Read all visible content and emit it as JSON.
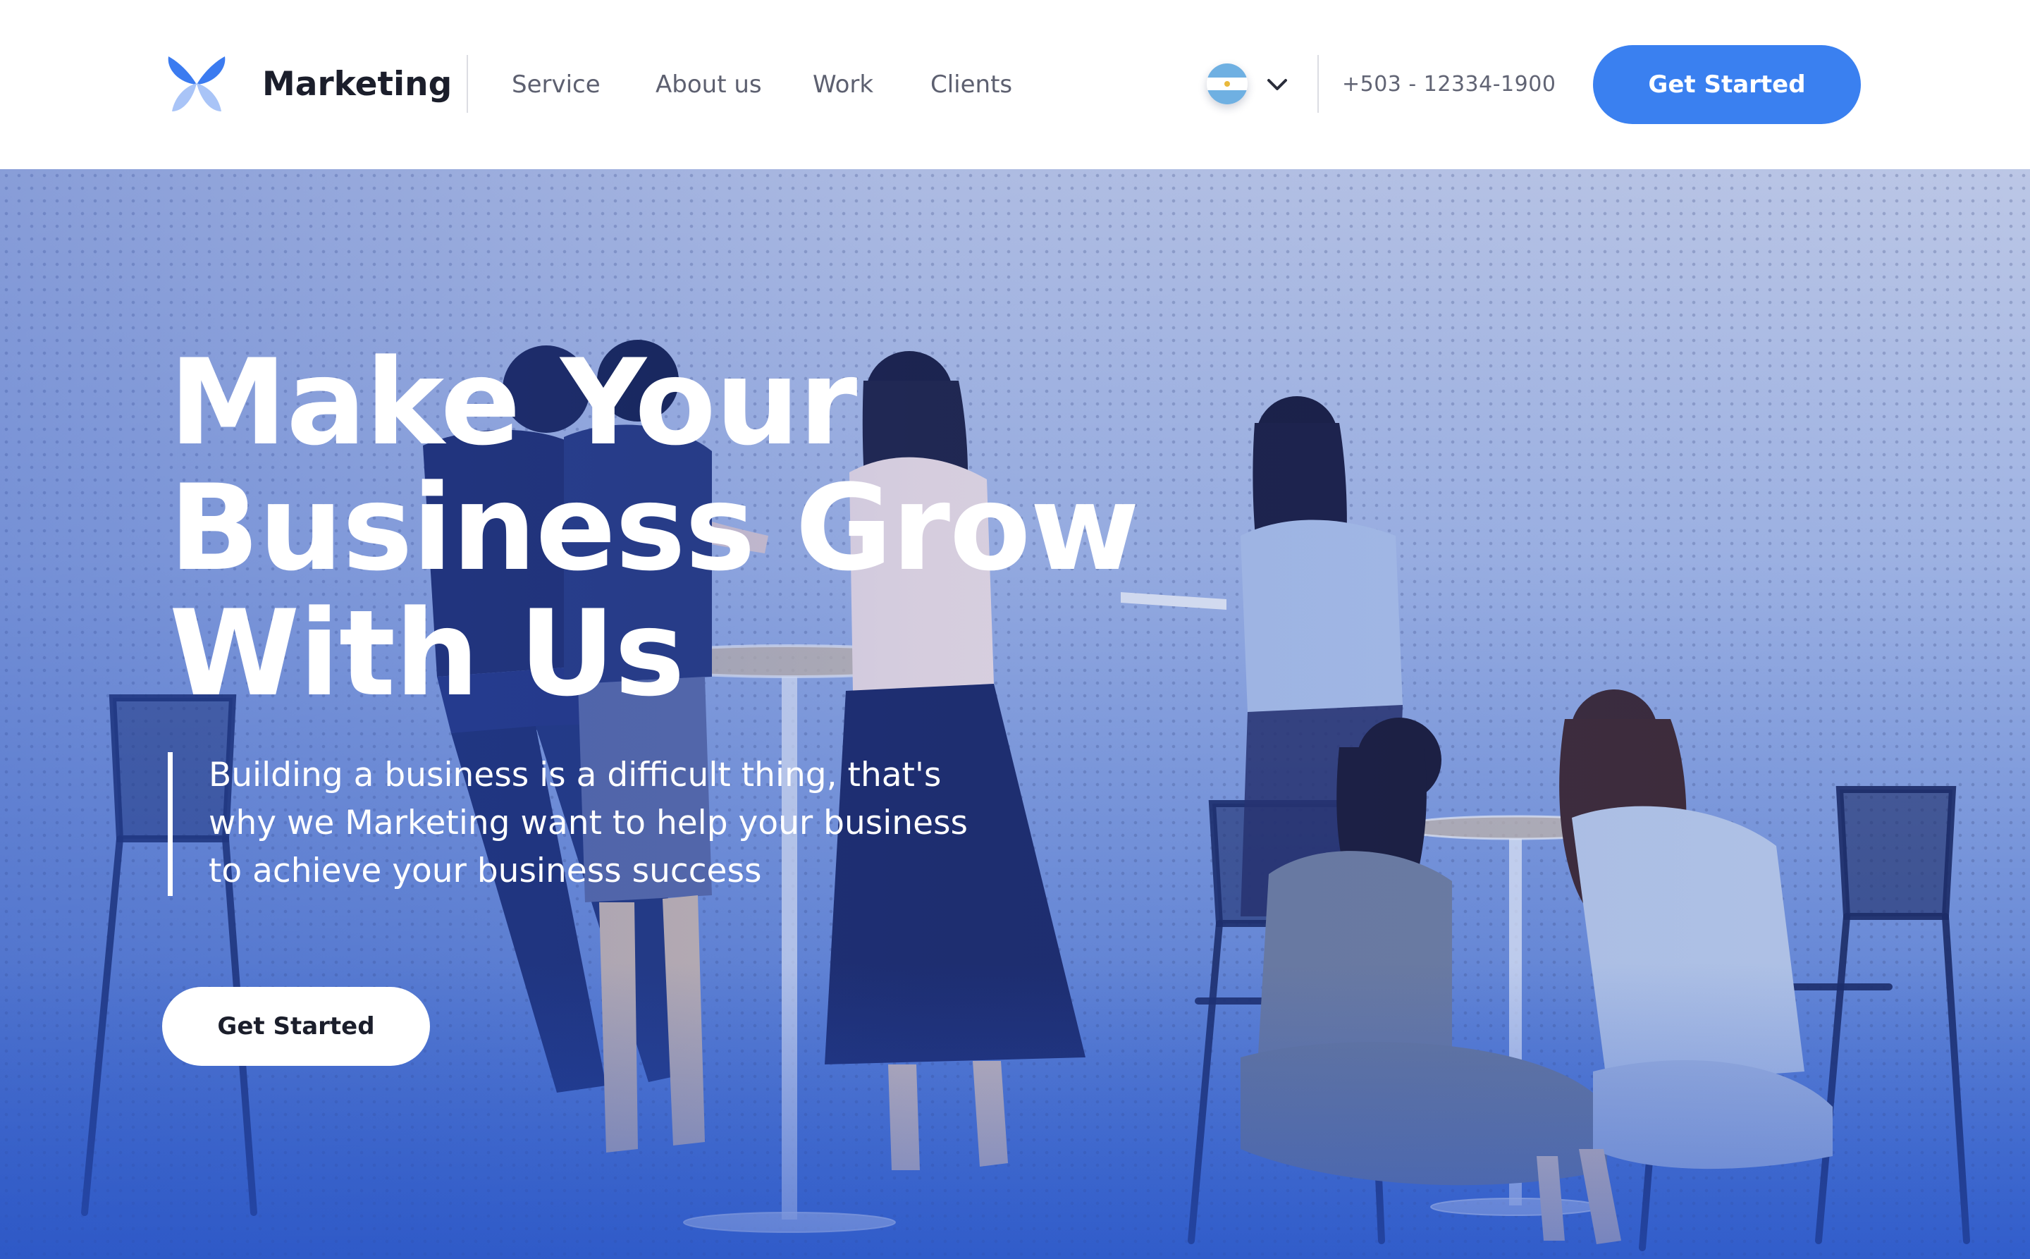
{
  "brand": {
    "name": "Marketing",
    "logo_icon": "butterfly-petal-logo",
    "colors": {
      "primary": "#3A80F0",
      "logo_dark": "#3B7BF0",
      "logo_light": "#A9C4F7",
      "text_dark": "#1B1E2B",
      "text_muted": "#5D6070"
    }
  },
  "nav": {
    "items": [
      {
        "label": "Service"
      },
      {
        "label": "About us"
      },
      {
        "label": "Work"
      },
      {
        "label": "Clients"
      }
    ]
  },
  "language": {
    "flag_icon": "argentina-flag-icon",
    "dropdown_icon": "chevron-down-icon"
  },
  "contact": {
    "phone": "+503 - 12334-1900"
  },
  "header_cta": {
    "label": "Get Started"
  },
  "hero": {
    "headline_lines": [
      "Make Your",
      "Business Grow",
      "With Us"
    ],
    "lead_lines": [
      "Building a business is a difficult thing, that's",
      "why we Marketing want to help your business",
      "to achieve your business success"
    ],
    "cta_label": "Get Started",
    "background_image": "team-meeting-photo-blue-tint"
  }
}
